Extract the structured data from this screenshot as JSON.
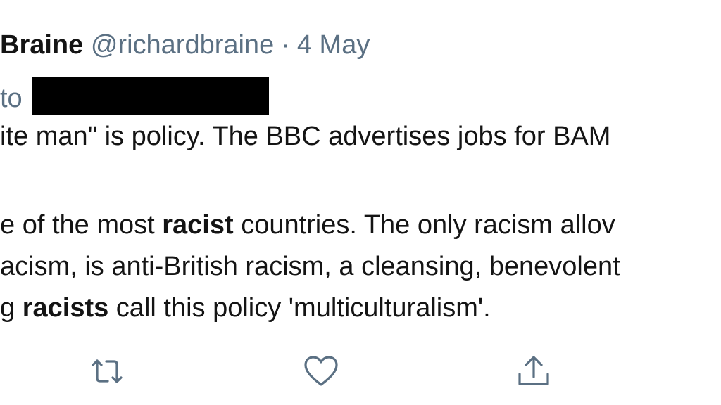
{
  "tweet": {
    "display_name": "Braine",
    "handle": "@richardbraine",
    "separator": "·",
    "date": "4 May",
    "reply_prefix": "to",
    "body": {
      "line1": "ite man\" is policy. The BBC advertises jobs for BAM",
      "line2_pre": "e of the most ",
      "line2_kw": "racist",
      "line2_post": " countries. The only racism allov",
      "line3": "acism, is anti-British racism, a cleansing, benevolent",
      "line4_pre": "g ",
      "line4_kw": "racists",
      "line4_post": " call this policy 'multiculturalism'."
    },
    "actions": {
      "retweet_icon": "retweet-icon",
      "like_icon": "heart-icon",
      "share_icon": "share-icon"
    }
  },
  "colors": {
    "text": "#141414",
    "muted": "#5b7083",
    "redaction": "#000000",
    "background": "#ffffff"
  }
}
